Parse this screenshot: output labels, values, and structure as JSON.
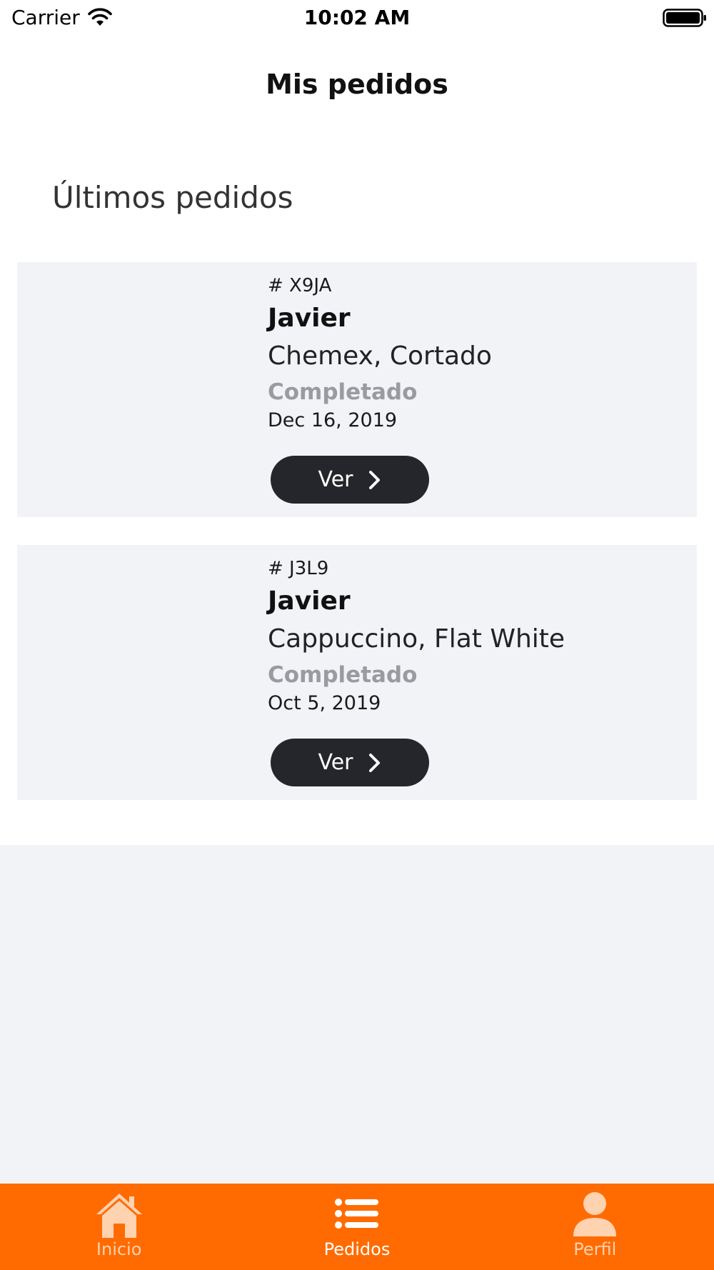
{
  "status_bar": {
    "carrier": "Carrier",
    "time": "10:02 AM"
  },
  "nav": {
    "title": "Mis pedidos"
  },
  "section": {
    "title": "Últimos pedidos"
  },
  "orders": [
    {
      "id": "# X9JA",
      "customer": "Javier",
      "items": "Chemex, Cortado",
      "status": "Completado",
      "date": "Dec 16, 2019",
      "button_label": "Ver"
    },
    {
      "id": "# J3L9",
      "customer": "Javier",
      "items": "Cappuccino, Flat White",
      "status": "Completado",
      "date": "Oct 5, 2019",
      "button_label": "Ver"
    }
  ],
  "tab_bar": {
    "tabs": [
      {
        "label": "Inicio",
        "icon": "home-icon",
        "active": false
      },
      {
        "label": "Pedidos",
        "icon": "list-icon",
        "active": true
      },
      {
        "label": "Perfil",
        "icon": "user-icon",
        "active": false
      }
    ],
    "accent_color": "#ff6b00",
    "inactive_color": "#ffd2b0",
    "active_color": "#ffffff"
  },
  "colors": {
    "card_background": "#f2f3f7",
    "button_background": "#24262b",
    "status_text": "#9a9ba1"
  }
}
